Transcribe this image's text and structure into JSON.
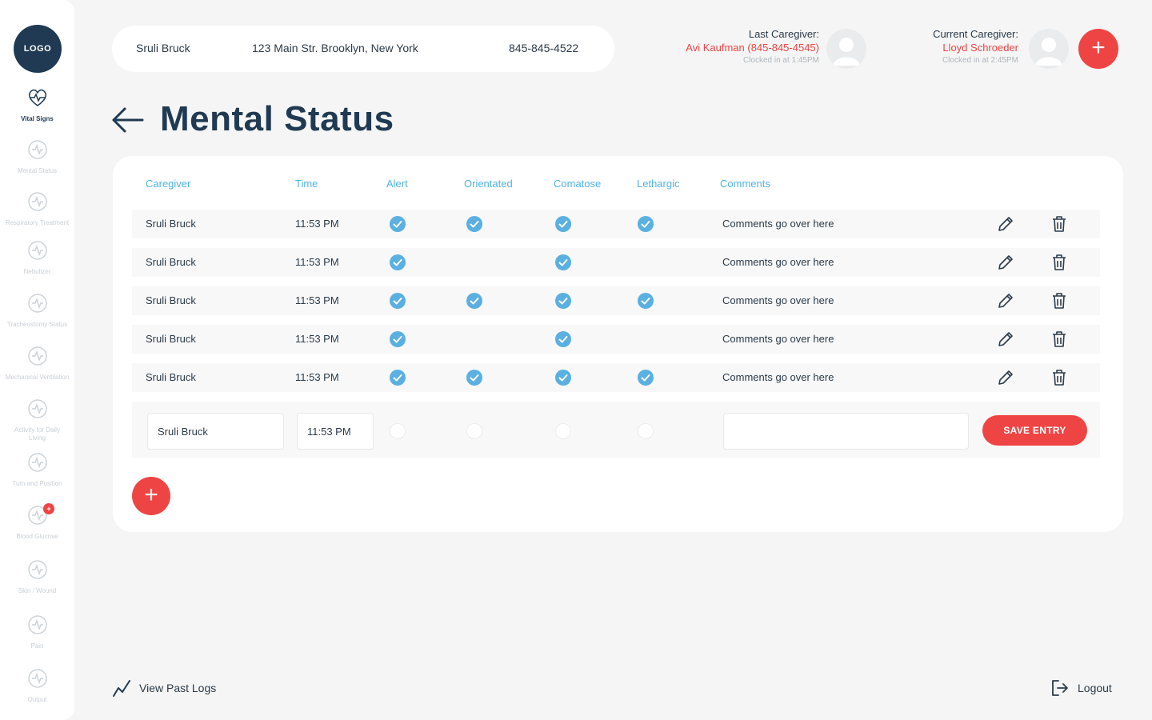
{
  "sidebar": {
    "logo": "LOGO",
    "items": [
      {
        "label": "Vital Signs",
        "icon": "heart-pulse-icon",
        "active": true
      },
      {
        "label": "Mental Status",
        "icon": "brain-icon"
      },
      {
        "label": "Respiratory Treatment",
        "icon": "lungs-icon"
      },
      {
        "label": "Nebulizer",
        "icon": "nebulizer-icon"
      },
      {
        "label": "Tracheostomy Status",
        "icon": "trachea-icon"
      },
      {
        "label": "Mechanical Ventilation",
        "icon": "ventilator-icon"
      },
      {
        "label": "Activity for Daily Living",
        "icon": "activity-icon"
      },
      {
        "label": "Turn and Position",
        "icon": "turn-icon"
      },
      {
        "label": "Blood Glucose",
        "icon": "glucose-icon",
        "badge": "+"
      },
      {
        "label": "Skin / Wound",
        "icon": "skin-icon"
      },
      {
        "label": "Pain",
        "icon": "pain-icon"
      },
      {
        "label": "Output",
        "icon": "output-icon"
      }
    ]
  },
  "patient": {
    "name": "Sruli Bruck",
    "address": "123 Main Str. Brooklyn, New York",
    "phone": "845-845-4522"
  },
  "last_caregiver": {
    "title": "Last Caregiver:",
    "name": "Avi Kaufman (845-845-4545)",
    "clock": "Clocked in at 1:45PM"
  },
  "current_caregiver": {
    "title": "Current Caregiver:",
    "name": "Lloyd Schroeder",
    "clock": "Clocked in at 2:45PM"
  },
  "add_top_label": "+",
  "page_title": "Mental Status",
  "table": {
    "headers": [
      "Caregiver",
      "Time",
      "Alert",
      "Orientated",
      "Comatose",
      "Lethargic",
      "Comments"
    ],
    "rows": [
      {
        "caregiver": "Sruli Bruck",
        "time": "11:53 PM",
        "alert": true,
        "orientated": true,
        "comatose": true,
        "lethargic": true,
        "comments": "Comments go over here"
      },
      {
        "caregiver": "Sruli Bruck",
        "time": "11:53 PM",
        "alert": true,
        "orientated": false,
        "comatose": true,
        "lethargic": false,
        "comments": "Comments go over here"
      },
      {
        "caregiver": "Sruli Bruck",
        "time": "11:53 PM",
        "alert": true,
        "orientated": true,
        "comatose": true,
        "lethargic": true,
        "comments": "Comments go over here"
      },
      {
        "caregiver": "Sruli Bruck",
        "time": "11:53 PM",
        "alert": true,
        "orientated": false,
        "comatose": true,
        "lethargic": false,
        "comments": "Comments go over here"
      },
      {
        "caregiver": "Sruli Bruck",
        "time": "11:53 PM",
        "alert": true,
        "orientated": true,
        "comatose": true,
        "lethargic": true,
        "comments": "Comments go over here"
      }
    ]
  },
  "entry": {
    "caregiver": "Sruli Bruck",
    "time": "11:53 PM",
    "comments": "",
    "save_label": "SAVE ENTRY"
  },
  "add_row_label": "+",
  "footer": {
    "past_logs": "View Past Logs",
    "logout": "Logout"
  },
  "colors": {
    "primary": "#1f3a52",
    "accent": "#ef4444",
    "check": "#5ab0e0",
    "header_text": "#4fb3e6"
  }
}
